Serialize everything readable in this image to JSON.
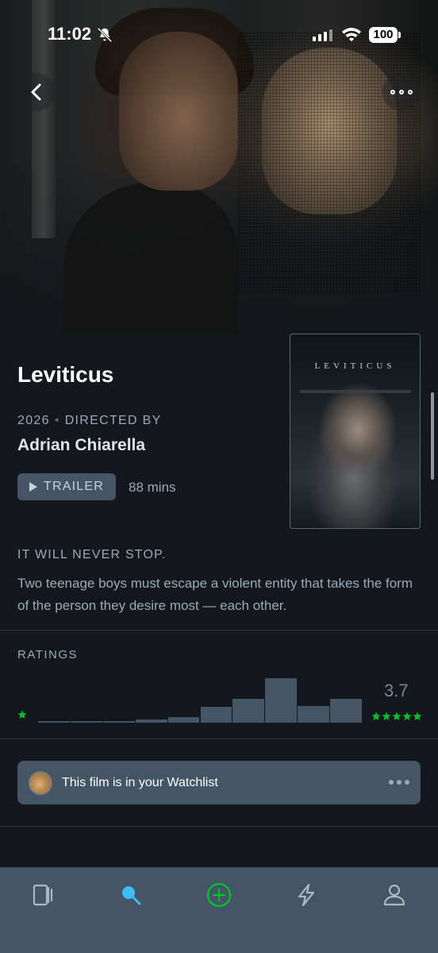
{
  "status_bar": {
    "time": "11:02",
    "battery": "100"
  },
  "film": {
    "title": "Leviticus",
    "year": "2026",
    "directed_by_label": "DIRECTED BY",
    "director": "Adrian Chiarella",
    "trailer_label": "TRAILER",
    "runtime": "88 mins",
    "poster_title": "LEVITICUS",
    "tagline": "IT WILL NEVER STOP.",
    "synopsis": "Two teenage boys must escape a violent entity that takes the form of the person they desire most — each other."
  },
  "ratings": {
    "label": "RATINGS",
    "average": "3.7",
    "star_color": "#00c030",
    "bar_color": "#445566",
    "histogram_relative": [
      0.02,
      0.02,
      0.02,
      0.07,
      0.12,
      0.35,
      0.54,
      1.0,
      0.38,
      0.54
    ]
  },
  "watchlist": {
    "text": "This film is in your Watchlist"
  },
  "tabs": [
    {
      "name": "films",
      "icon": "films-icon",
      "active": false
    },
    {
      "name": "search",
      "icon": "search-icon",
      "active": true
    },
    {
      "name": "add",
      "icon": "add-icon",
      "active": false
    },
    {
      "name": "activity",
      "icon": "lightning-icon",
      "active": false
    },
    {
      "name": "profile",
      "icon": "profile-icon",
      "active": false
    }
  ],
  "colors": {
    "accent_green": "#00c030",
    "accent_blue": "#40bcf4",
    "background": "#14181c",
    "muted_text": "#99aabb"
  }
}
